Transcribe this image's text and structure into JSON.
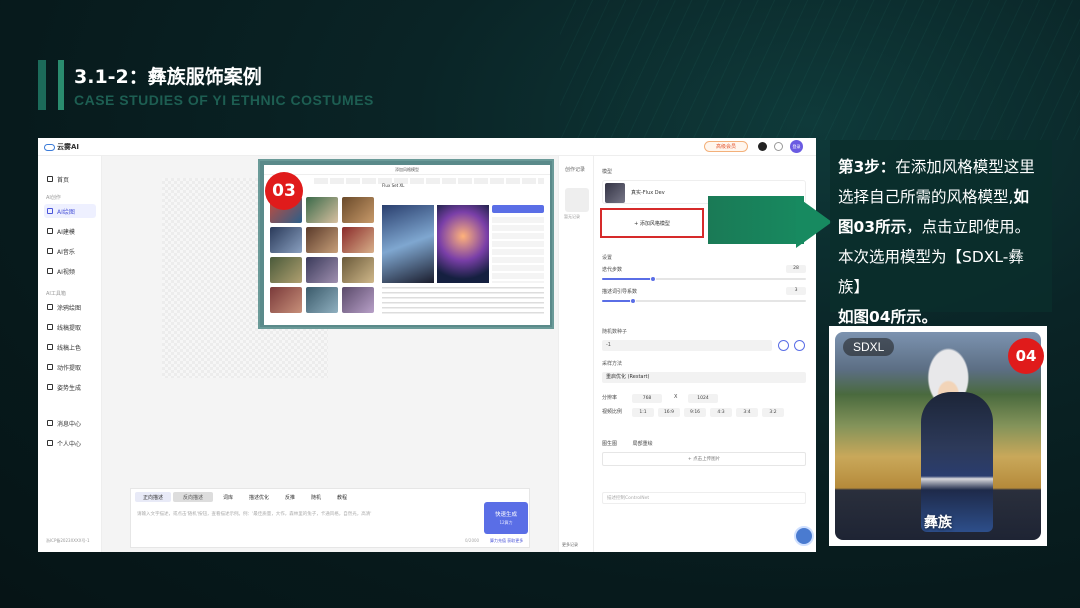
{
  "slide": {
    "title": "3.1-2：彝族服饰案例",
    "subtitle": "CASE STUDIES OF YI ETHNIC COSTUMES"
  },
  "app": {
    "logo_text": "云雾AI",
    "vip_label": "高级会员",
    "avatar_label": "登录",
    "sidebar": {
      "group1": "AI创作",
      "items1": [
        {
          "label": "首页"
        },
        {
          "label": "AI绘图"
        },
        {
          "label": "AI建模"
        },
        {
          "label": "AI音乐"
        },
        {
          "label": "AI视频"
        }
      ],
      "group2": "AI工具箱",
      "items2": [
        {
          "label": "涂鸦绘图"
        },
        {
          "label": "线稿提取"
        },
        {
          "label": "线稿上色"
        },
        {
          "label": "动作提取"
        },
        {
          "label": "姿势生成"
        }
      ],
      "items3": [
        {
          "label": "消息中心"
        },
        {
          "label": "个人中心"
        }
      ],
      "footer": "浙ICP备2023XXXX号-1"
    },
    "prompt": {
      "tab_positive": "正向描述",
      "tab_negative": "反向描述",
      "tools": [
        "词库",
        "描述优化",
        "反推",
        "随机",
        "教程"
      ],
      "placeholder": "请输入文字描述，或点击'随机'按钮，查看描述示例。例：'最佳质量，大作，森林里的兔子，卡通风格，自然光，高清'",
      "counter": "0/2000",
      "generate_label": "快速生成",
      "generate_sub": "12算力",
      "note": "算力充值 获取更多"
    },
    "history": {
      "title": "创作记录",
      "thumb_label": "暂无记录",
      "footer": "更多记录"
    },
    "panel": {
      "model_label": "模型",
      "model_name": "真实-Flux Dev",
      "add_style": "+ 添加风格模型",
      "settings_label": "设置",
      "steps_label": "迭代步数",
      "steps_value": "28",
      "steps_fraction": 0.25,
      "cfg_label": "描述词引导系数",
      "cfg_value": "3",
      "cfg_fraction": 0.15,
      "seed_label": "随机数种子",
      "seed_value": "-1",
      "sampler_label": "采样方法",
      "sampler_value": "重启优化 (Restart)",
      "resolution_label": "分辨率",
      "width": "768",
      "x_label": "X",
      "height": "1024",
      "ratio_label": "视频比例",
      "ratios": [
        "1:1",
        "16:9",
        "9:16",
        "4:3",
        "3:4",
        "3:2"
      ],
      "ref_image_label": "图生图",
      "ref_control_label": "局部重绘",
      "upload_label": "+ 点击上传图片",
      "negative_placeholder": "描述控制ControlNet"
    }
  },
  "overlay03": {
    "badge": "03",
    "window_title": "添加风格模型",
    "model_title": "Flux Set XL"
  },
  "step": {
    "lead": "第3步：",
    "line1": "在添加风格模型这里",
    "line2a": "选择自己所需的风格模型,",
    "line2b": "如",
    "line3a": "图03所示",
    "line3b": "，点击立即使用。",
    "line4": "本次选用模型为【SDXL-彝族】",
    "line5": "如图04所示。"
  },
  "photo04": {
    "badge": "04",
    "tag": "SDXL",
    "caption": "彝族"
  },
  "colors": {
    "accent": "#5a6ee6",
    "highlight_red": "#d62a2a",
    "badge_red": "#e01b1b",
    "arrow_green": "#178a60",
    "bg_dark": "#071a1c"
  }
}
